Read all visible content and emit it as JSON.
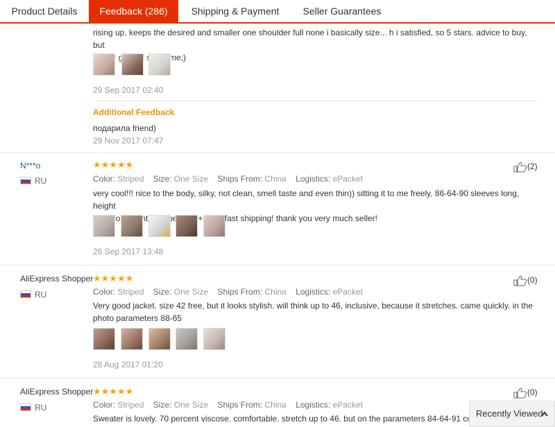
{
  "tabs": [
    {
      "label": "Product Details"
    },
    {
      "label": "Feedback (286)"
    },
    {
      "label": "Shipping & Payment"
    },
    {
      "label": "Seller Guarantees"
    }
  ],
  "review0": {
    "text_line1": "rising up, keeps the desired and smaller one shoulder full none i basically size... h i satisfied, so 5 stars. advice to buy, but",
    "text_line2": "bigger girls all same me;)",
    "date": "29 Sep 2017 02:40",
    "additional_label": "Additional Feedback",
    "additional_text": "подарила friend)",
    "additional_date": "29 Nov 2017 07:47",
    "thumb_colors": [
      "#c9a9a0",
      "#8a6a5e",
      "#d9d2cc"
    ]
  },
  "labels": {
    "color": "Color:",
    "size": "Size:",
    "ships_from": "Ships From:",
    "logistics": "Logistics:"
  },
  "reviews": [
    {
      "user": "N***o",
      "country": "RU",
      "stars": "★★★★★",
      "color": "Striped",
      "size": "One Size",
      "ships_from": "China",
      "logistics": "ePacket",
      "helpful": "(2)",
      "text_line1": "very cool!!! nice to the body, silky, not clean, smell taste and even thin)) sitting it to me freely, 86-64-90 sleeves long, height",
      "text_line2": "170. color gentle. super in a +++++ fast shipping! thank you very much seller!",
      "date": "26 Sep 2017 13:48",
      "thumb_colors": [
        "#b7aca6",
        "#8b7869",
        "#cfd7dc",
        "#7a5f54",
        "#b9a39e"
      ]
    },
    {
      "user": "AliExpress Shopper",
      "country": "RU",
      "stars": "★★★★★",
      "color": "Striped",
      "size": "One Size",
      "ships_from": "China",
      "logistics": "ePacket",
      "helpful": "(0)",
      "text_line1": "Very good jacket. size 42 free, but it looks stylish. will think up to 46, inclusive, because it stretches. came quickly. in the",
      "text_line2": "photo parameters 88-65",
      "date": "28 Aug 2017 01:20",
      "thumb_colors": [
        "#8a6656",
        "#9d7263",
        "#a17e64",
        "#a39c98",
        "#c4b4ad"
      ]
    },
    {
      "user": "AliExpress Shopper",
      "country": "RU",
      "stars": "★★★★★",
      "color": "Striped",
      "size": "One Size",
      "ships_from": "China",
      "logistics": "ePacket",
      "helpful": "(0)",
      "text_line1": "Sweater is lovely. 70 percent viscose. comfortable. stretch up to 46. but on the parameters 84-64-91 com"
    }
  ],
  "recently_viewed": "Recently Viewed",
  "colors": {
    "accent": "#e62e04",
    "star": "#f7a406",
    "additional": "#f09000",
    "link": "#1a5fa8"
  }
}
